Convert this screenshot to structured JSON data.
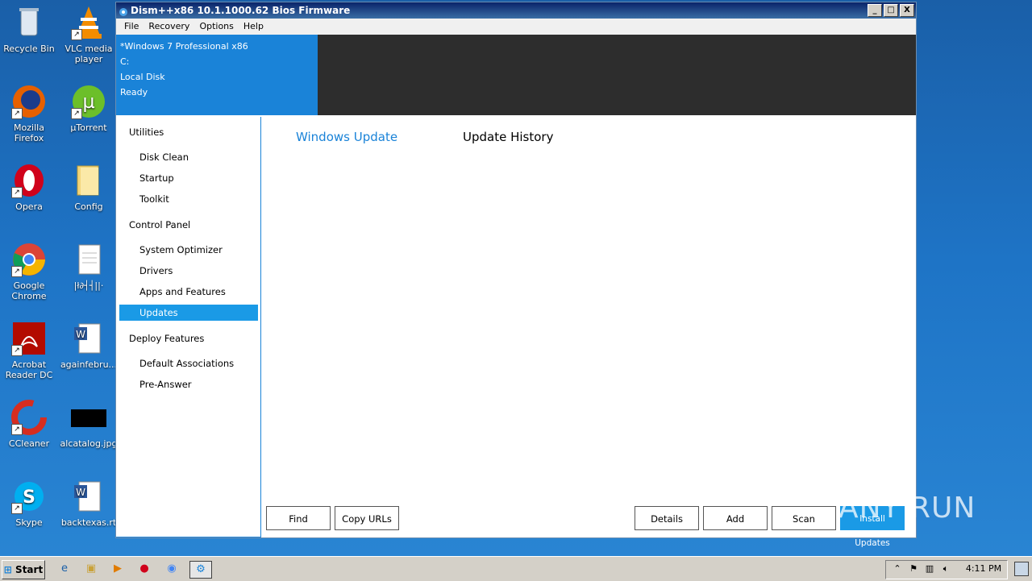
{
  "desktop": {
    "icons": [
      {
        "label": "Recycle Bin"
      },
      {
        "label": "VLC media player"
      },
      {
        "label": "Mozilla Firefox"
      },
      {
        "label": "µTorrent"
      },
      {
        "label": "Opera"
      },
      {
        "label": "Config"
      },
      {
        "label": "Google Chrome"
      },
      {
        "label": "|ł∂┤┤||·"
      },
      {
        "label": "Acrobat Reader DC"
      },
      {
        "label": "againfebru..."
      },
      {
        "label": "CCleaner"
      },
      {
        "label": "alcatalog.jpg"
      },
      {
        "label": "Skype"
      },
      {
        "label": "backtexas.rt"
      }
    ]
  },
  "window": {
    "title": "Dism++x86 10.1.1000.62 Bios Firmware",
    "controls": {
      "minimize": "_",
      "maximize": "□",
      "close": "X"
    },
    "menu": [
      "File",
      "Recovery",
      "Options",
      "Help"
    ],
    "info": {
      "os": "*Windows 7 Professional x86",
      "drive": "C:",
      "disk": "Local Disk",
      "status": "Ready"
    },
    "sidebar": {
      "groups": [
        {
          "label": "Utilities",
          "items": [
            "Disk Clean",
            "Startup",
            "Toolkit"
          ]
        },
        {
          "label": "Control Panel",
          "items": [
            "System Optimizer",
            "Drivers",
            "Apps and Features",
            "Updates"
          ]
        },
        {
          "label": "Deploy Features",
          "items": [
            "Default Associations",
            "Pre-Answer"
          ]
        }
      ],
      "active": "Updates"
    },
    "tabs": [
      "Windows Update",
      "Update History"
    ],
    "buttons": {
      "find": "Find",
      "copy_urls": "Copy URLs",
      "details": "Details",
      "add": "Add",
      "scan": "Scan",
      "install": "Install Updates"
    }
  },
  "taskbar": {
    "start": "Start",
    "clock": "4:11 PM"
  },
  "watermark": "ANY RUN",
  "colors": {
    "accent": "#1a83d8",
    "active_item": "#1a9ae6",
    "dark_panel": "#2d2d2d"
  }
}
